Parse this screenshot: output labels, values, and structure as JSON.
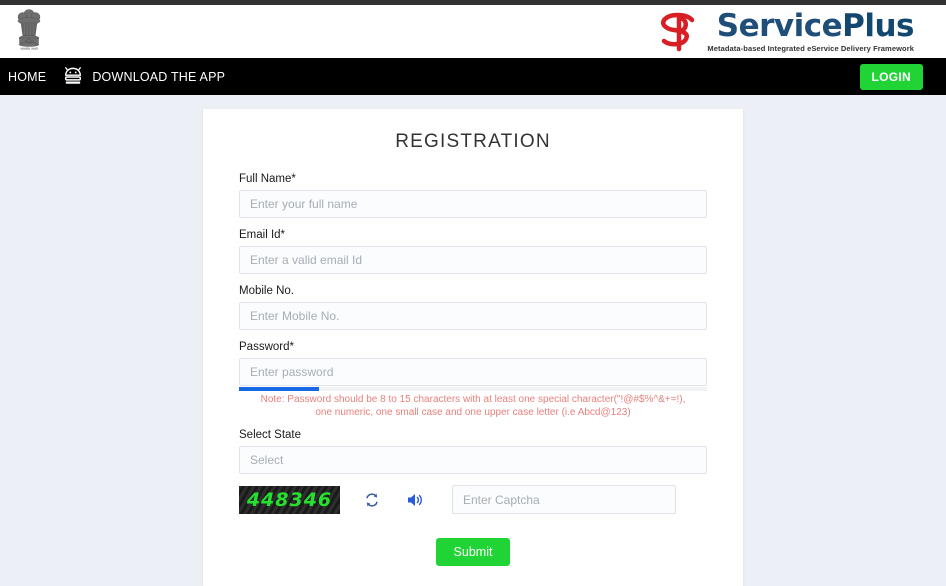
{
  "header": {
    "emblem_name": "india-national-emblem",
    "emblem_caption": "सत्यमेव जयते",
    "brand": {
      "title_part1": "Service",
      "title_part2": "Plus",
      "tagline": "Metadata-based Integrated eService Delivery Framework",
      "mark_color": "#d91f26",
      "title_color": "#1f4e79"
    }
  },
  "navbar": {
    "items": [
      {
        "label": "HOME",
        "icon": ""
      },
      {
        "label": "DOWNLOAD THE APP",
        "icon": "android-icon"
      }
    ],
    "home_label": "HOME",
    "download_label": "DOWNLOAD THE APP",
    "login_label": "LOGIN",
    "login_color": "#21d435",
    "background": "#000000"
  },
  "form": {
    "title": "REGISTRATION",
    "fields": {
      "full_name": {
        "label": "Full Name",
        "required_mark": "*",
        "placeholder": "Enter your full name",
        "value": ""
      },
      "email": {
        "label": "Email Id",
        "required_mark": "*",
        "placeholder": "Enter a valid email Id",
        "value": ""
      },
      "mobile": {
        "label": "Mobile No.",
        "required_mark": "",
        "placeholder": "Enter Mobile No.",
        "value": ""
      },
      "password": {
        "label": "Password",
        "required_mark": "*",
        "placeholder": "Enter password",
        "value": "",
        "strength_percent": 17,
        "strength_color": "#1668e3",
        "note_line1": "Note: Password should be 8 to 15 characters with at least one special character(\"!@#$%^&+=!),",
        "note_line2": "one numeric, one small case and one upper case letter (i.e Abcd@123)",
        "note_color": "#e8817d"
      },
      "state": {
        "label": "Select State",
        "required_mark": "",
        "placeholder": "Select",
        "value": "Select",
        "options": [
          "Select"
        ]
      },
      "captcha": {
        "code": "448346",
        "code_color": "#25e02e",
        "refresh_icon": "refresh-icon",
        "sound_icon": "speaker-icon",
        "placeholder": "Enter Captcha",
        "value": ""
      }
    },
    "submit_label": "Submit",
    "submit_color": "#21d435"
  },
  "page": {
    "background": "#eceff5",
    "card_background": "#ffffff"
  }
}
